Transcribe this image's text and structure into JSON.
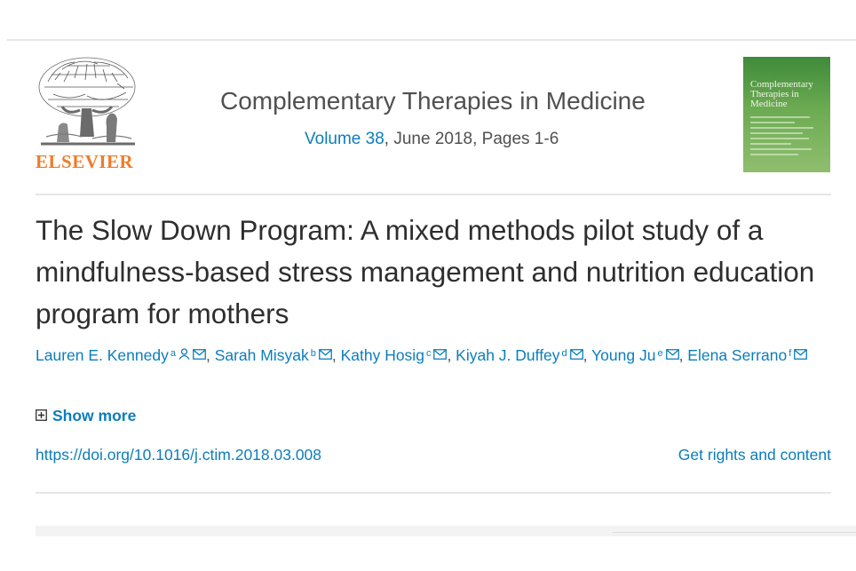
{
  "publisher": {
    "name": "ELSEVIER"
  },
  "journal": {
    "title": "Complementary Therapies in Medicine",
    "volume_link": "Volume 38",
    "issue_info": ", June 2018, Pages 1-6",
    "cover_title": "Complementary Therapies in Medicine"
  },
  "article": {
    "title": "The Slow Down Program: A mixed methods pilot study of a mindfulness-based stress management and nutrition education program for mothers"
  },
  "authors": [
    {
      "name": "Lauren E. Kennedy",
      "sup": "a",
      "icons": [
        "person-icon",
        "mail-icon"
      ],
      "sep": ", "
    },
    {
      "name": "Sarah Misyak",
      "sup": "b",
      "icons": [
        "mail-icon"
      ],
      "sep": ", "
    },
    {
      "name": "Kathy Hosig",
      "sup": "c",
      "icons": [
        "mail-icon"
      ],
      "sep": ", "
    },
    {
      "name": "Kiyah J. Duffey",
      "sup": "d",
      "icons": [
        "mail-icon"
      ],
      "sep": ", "
    },
    {
      "name": "Young Ju",
      "sup": "e",
      "icons": [
        "mail-icon"
      ],
      "sep": ", "
    },
    {
      "name": "Elena Serrano",
      "sup": "f",
      "icons": [
        "mail-icon"
      ],
      "sep": ""
    }
  ],
  "show_more": {
    "label": "Show more",
    "icon": "plus-box-icon"
  },
  "doi": "https://doi.org/10.1016/j.ctim.2018.03.008",
  "rights_link": "Get rights and content",
  "colors": {
    "link": "#0c7dbb",
    "elsevier_orange": "#ee7c2a",
    "text": "#2e2e2e",
    "cover_green": "#5a9b47"
  }
}
